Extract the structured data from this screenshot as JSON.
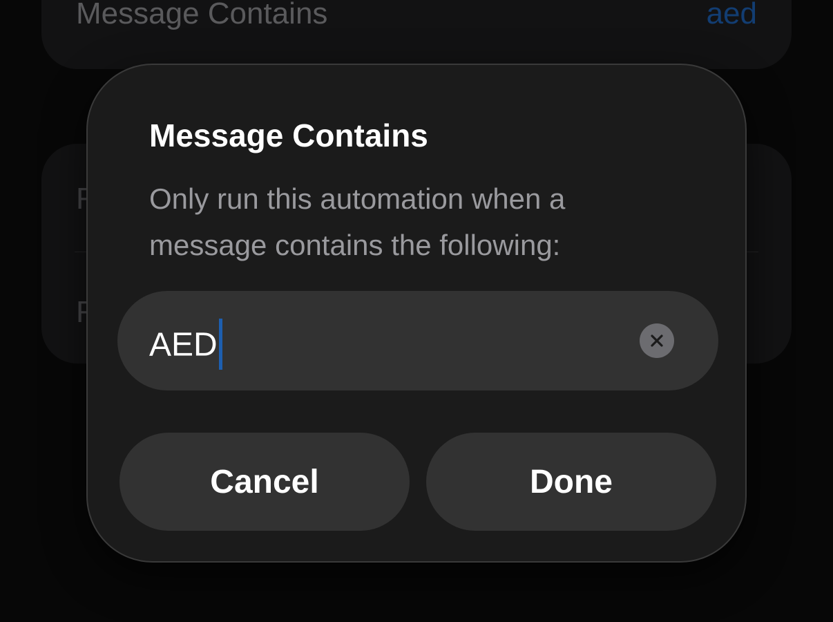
{
  "background": {
    "top_row": {
      "label": "Message Contains",
      "value": "aed"
    },
    "mid_rows": [
      "R",
      "R"
    ]
  },
  "alert": {
    "title": "Message Contains",
    "message": "Only run this automation when a message contains the following:",
    "field": {
      "value": "AED"
    },
    "clear_icon": "xmark-circle-icon",
    "buttons": {
      "cancel": "Cancel",
      "done": "Done"
    }
  },
  "colors": {
    "accent": "#1d5fb0",
    "alert_bg": "#1b1b1b",
    "control_bg": "#323232"
  }
}
